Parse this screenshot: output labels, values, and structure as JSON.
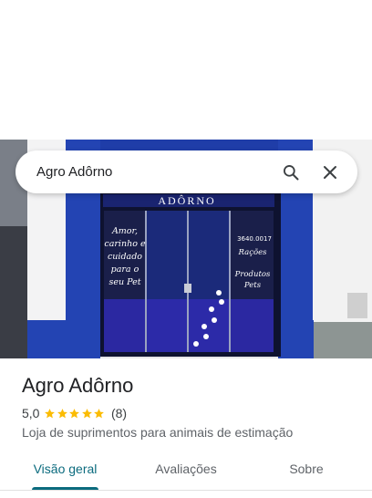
{
  "search": {
    "query": "Agro Adôrno"
  },
  "place": {
    "name": "Agro Adôrno",
    "rating": "5,0",
    "stars": 5,
    "review_count": "(8)",
    "category": "Loja de suprimentos para animais de estimação"
  },
  "tabs": [
    {
      "label": "Visão geral",
      "active": true
    },
    {
      "label": "Avaliações",
      "active": false
    },
    {
      "label": "Sobre",
      "active": false
    }
  ],
  "storefront": {
    "sign": "ADÔRNO",
    "left_window": [
      "Amor,",
      "carinho e",
      "cuidado",
      "para o",
      "seu Pet"
    ],
    "phone": "3640.0017",
    "right_window": [
      "Rações",
      "Produtos",
      "Pets"
    ]
  },
  "colors": {
    "accent": "#0b6b7e",
    "star": "#fbbc04",
    "facade_blue": "#1f3da8"
  }
}
